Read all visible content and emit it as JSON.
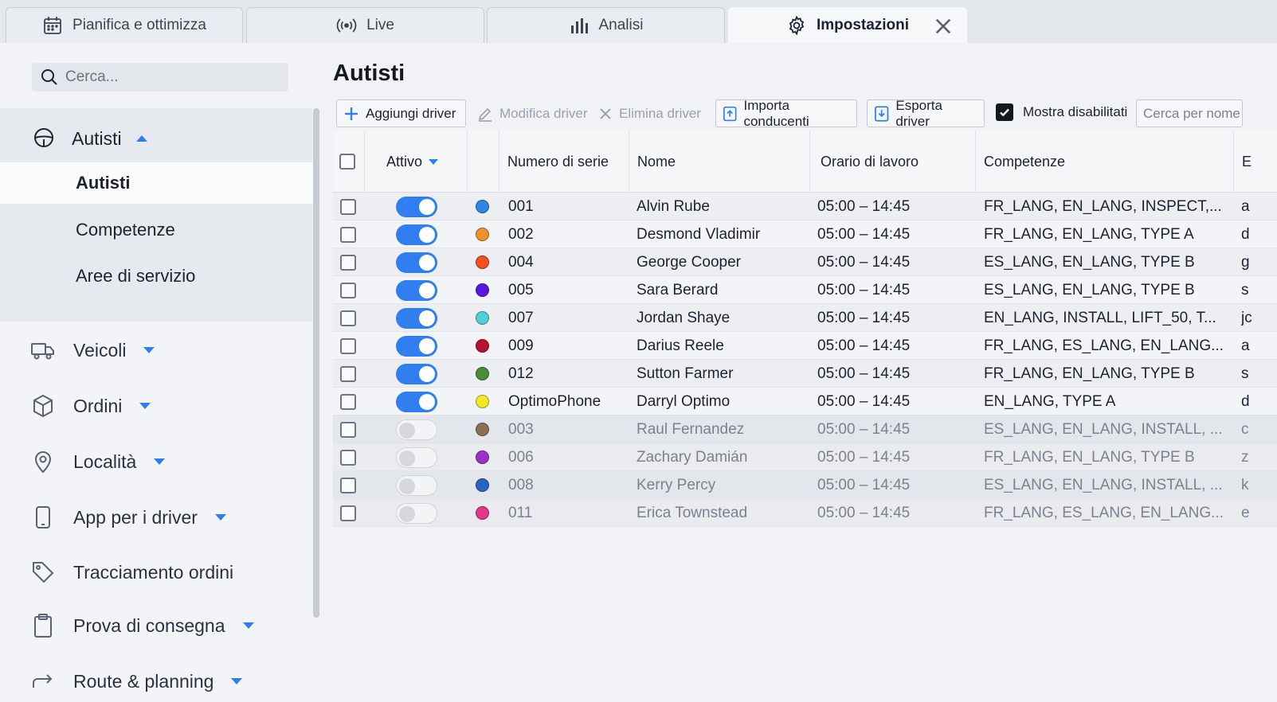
{
  "tabs": [
    {
      "label": "Pianifica e ottimizza",
      "icon": "calendar-icon"
    },
    {
      "label": "Live",
      "icon": "broadcast-icon"
    },
    {
      "label": "Analisi",
      "icon": "bar-chart-icon"
    },
    {
      "label": "Impostazioni",
      "icon": "gear-icon",
      "active": true
    }
  ],
  "sidebar": {
    "search_placeholder": "Cerca...",
    "section": {
      "label": "Autisti",
      "icon": "steering-icon",
      "items": [
        {
          "label": "Autisti",
          "active": true
        },
        {
          "label": "Competenze"
        },
        {
          "label": "Aree di servizio"
        }
      ]
    },
    "nav": [
      {
        "label": "Veicoli",
        "icon": "truck-icon",
        "caret": true
      },
      {
        "label": "Ordini",
        "icon": "box-icon",
        "caret": true
      },
      {
        "label": "Località",
        "icon": "pin-icon",
        "caret": true
      },
      {
        "label": "App per i driver",
        "icon": "phone-icon",
        "caret": true
      },
      {
        "label": "Tracciamento ordini",
        "icon": "tag-icon",
        "caret": false
      },
      {
        "label": "Prova di consegna",
        "icon": "clipboard-icon",
        "caret": true
      },
      {
        "label": "Route & planning",
        "icon": "route-icon",
        "caret": true
      }
    ]
  },
  "main": {
    "title": "Autisti",
    "toolbar": {
      "add": "Aggiungi driver",
      "edit": "Modifica driver",
      "delete": "Elimina driver",
      "import": "Importa conducenti",
      "export": "Esporta driver",
      "show_disabled": "Mostra disabilitati",
      "search_placeholder": "Cerca per nome"
    },
    "columns": {
      "active": "Attivo",
      "serial": "Numero di serie",
      "name": "Nome",
      "hours": "Orario di lavoro",
      "skills": "Competenze",
      "extra": "E"
    },
    "rows": [
      {
        "active": true,
        "color": "#2f86e0",
        "serial": "001",
        "name": "Alvin Rube",
        "hours": "05:00 – 14:45",
        "skills": "FR_LANG, EN_LANG, INSPECT,...",
        "extra": "a"
      },
      {
        "active": true,
        "color": "#f0922b",
        "serial": "002",
        "name": "Desmond Vladimir",
        "hours": "05:00 – 14:45",
        "skills": "FR_LANG, EN_LANG, TYPE A",
        "extra": "d"
      },
      {
        "active": true,
        "color": "#f0521f",
        "serial": "004",
        "name": "George Cooper",
        "hours": "05:00 – 14:45",
        "skills": "ES_LANG, EN_LANG, TYPE B",
        "extra": "g"
      },
      {
        "active": true,
        "color": "#5a17e0",
        "serial": "005",
        "name": "Sara Berard",
        "hours": "05:00 – 14:45",
        "skills": "ES_LANG, EN_LANG, TYPE B",
        "extra": "s"
      },
      {
        "active": true,
        "color": "#4fcfd8",
        "serial": "007",
        "name": "Jordan Shaye",
        "hours": "05:00 – 14:45",
        "skills": "EN_LANG, INSTALL, LIFT_50, T...",
        "extra": "jc"
      },
      {
        "active": true,
        "color": "#b8102e",
        "serial": "009",
        "name": "Darius Reele",
        "hours": "05:00 – 14:45",
        "skills": "FR_LANG, ES_LANG, EN_LANG...",
        "extra": "a"
      },
      {
        "active": true,
        "color": "#4a8a3b",
        "serial": "012",
        "name": "Sutton Farmer",
        "hours": "05:00 – 14:45",
        "skills": "FR_LANG, EN_LANG, TYPE B",
        "extra": "s"
      },
      {
        "active": true,
        "color": "#f2e82a",
        "serial": "OptimoPhone",
        "name": "Darryl Optimo",
        "hours": "05:00 – 14:45",
        "skills": "EN_LANG, TYPE A",
        "extra": "d"
      },
      {
        "active": false,
        "color": "#8a6f57",
        "serial": "003",
        "name": "Raul Fernandez",
        "hours": "05:00 – 14:45",
        "skills": "ES_LANG, EN_LANG, INSTALL, ...",
        "extra": "c"
      },
      {
        "active": false,
        "color": "#9a32c8",
        "serial": "006",
        "name": "Zachary Damián",
        "hours": "05:00 – 14:45",
        "skills": "FR_LANG, EN_LANG, TYPE B",
        "extra": "z"
      },
      {
        "active": false,
        "color": "#2c63c0",
        "serial": "008",
        "name": "Kerry Percy",
        "hours": "05:00 – 14:45",
        "skills": "ES_LANG, EN_LANG, INSTALL, ...",
        "extra": "k"
      },
      {
        "active": false,
        "color": "#e0388a",
        "serial": "011",
        "name": "Erica Townstead",
        "hours": "05:00 – 14:45",
        "skills": "FR_LANG, ES_LANG, EN_LANG...",
        "extra": "e"
      }
    ]
  }
}
